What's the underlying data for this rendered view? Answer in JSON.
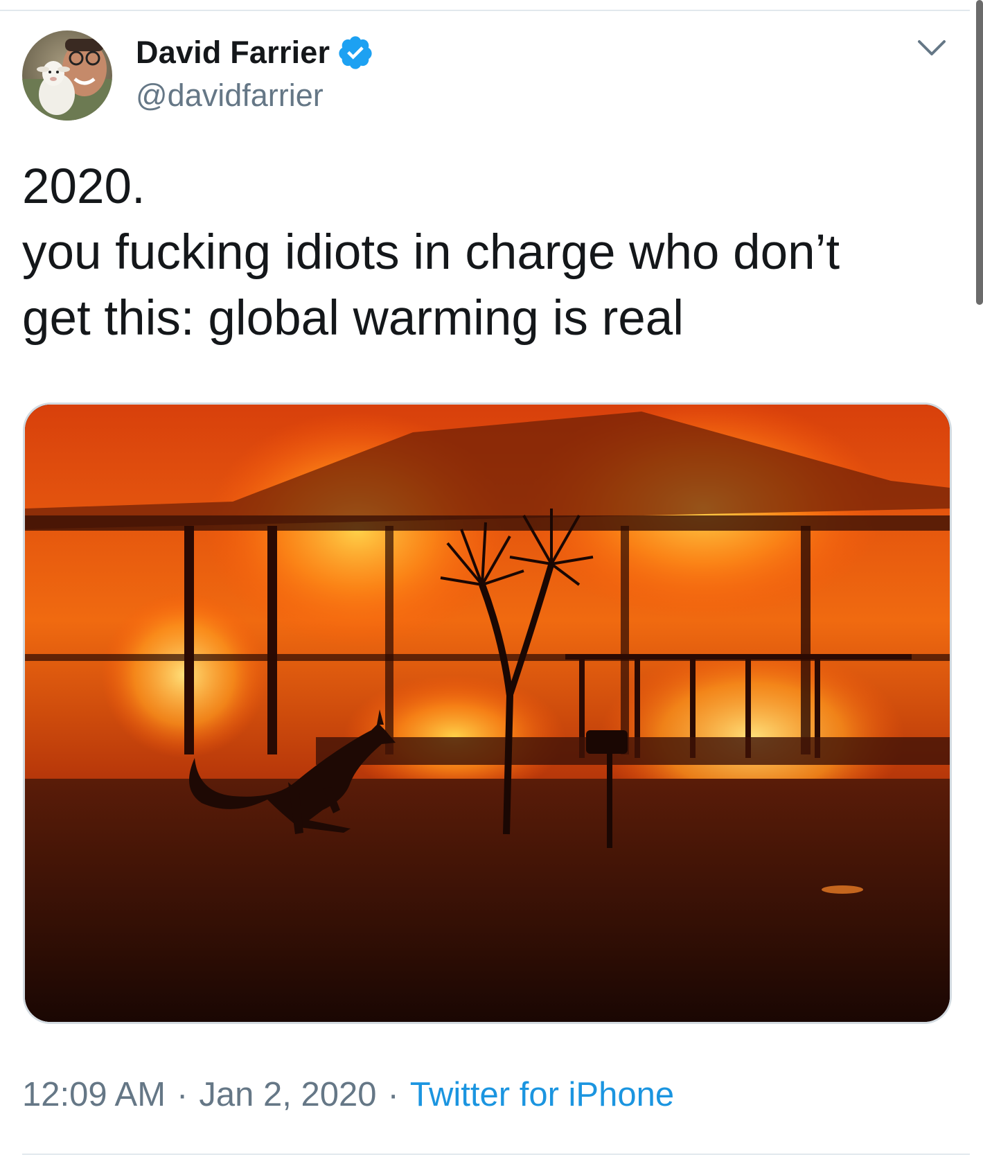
{
  "author": {
    "display_name": "David Farrier",
    "handle": "@davidfarrier",
    "verified": true,
    "verified_color": "#1da1f2"
  },
  "tweet": {
    "lines": [
      "2020.",
      "you fucking idiots in charge who don’t",
      "get this: global warming is real"
    ]
  },
  "media": {
    "type": "photo"
  },
  "meta": {
    "time": "12:09 AM",
    "separator": "·",
    "date": "Jan 2, 2020",
    "source": "Twitter for iPhone",
    "source_color": "#1b95e0"
  },
  "icons": {
    "verified": "verified-badge-icon",
    "caret": "chevron-down-icon"
  }
}
